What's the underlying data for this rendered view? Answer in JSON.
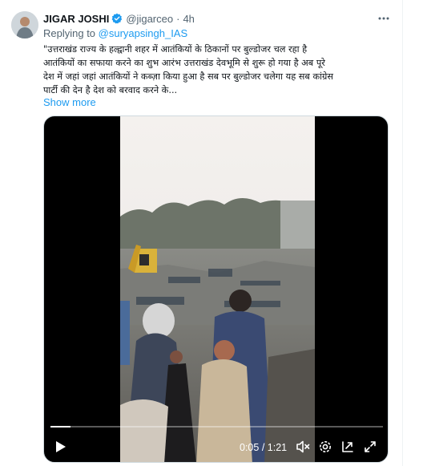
{
  "tweet": {
    "author_name": "JIGAR JOSHI",
    "handle": "@jigarceo",
    "separator": "·",
    "time": "4h",
    "reply_prefix": "Replying to",
    "reply_to": "@suryapsingh_IAS",
    "text_lines": [
      "\"उत्तराखंड राज्य के हल्द्वानी शहर में आतंकियों के ठिकानों पर बुल्डोजर चल रहा है",
      "आतंकियों का सफाया करने का शुभ आरंभ उत्तराखंड देवभूमि से शुरू हो गया है अब पूरे",
      "देश में जहां जहां आतंकियों ने कब्ज़ा किया हुआ है सब पर बुल्डोजर चलेगा यह सब कांग्रेस",
      "पार्टी की देन है देश को बरवाद करने के..."
    ],
    "show_more": "Show more"
  },
  "video": {
    "current_time": "0:05",
    "time_separator": "/",
    "duration": "1:21",
    "progress": 0.06,
    "controls": [
      "play-icon",
      "mute-icon",
      "settings-icon",
      "pip-icon",
      "fullscreen-icon"
    ]
  },
  "colors": {
    "link": "#1d9bf0",
    "muted": "#536471",
    "text": "#0f1419",
    "video_bg": "#000000"
  }
}
